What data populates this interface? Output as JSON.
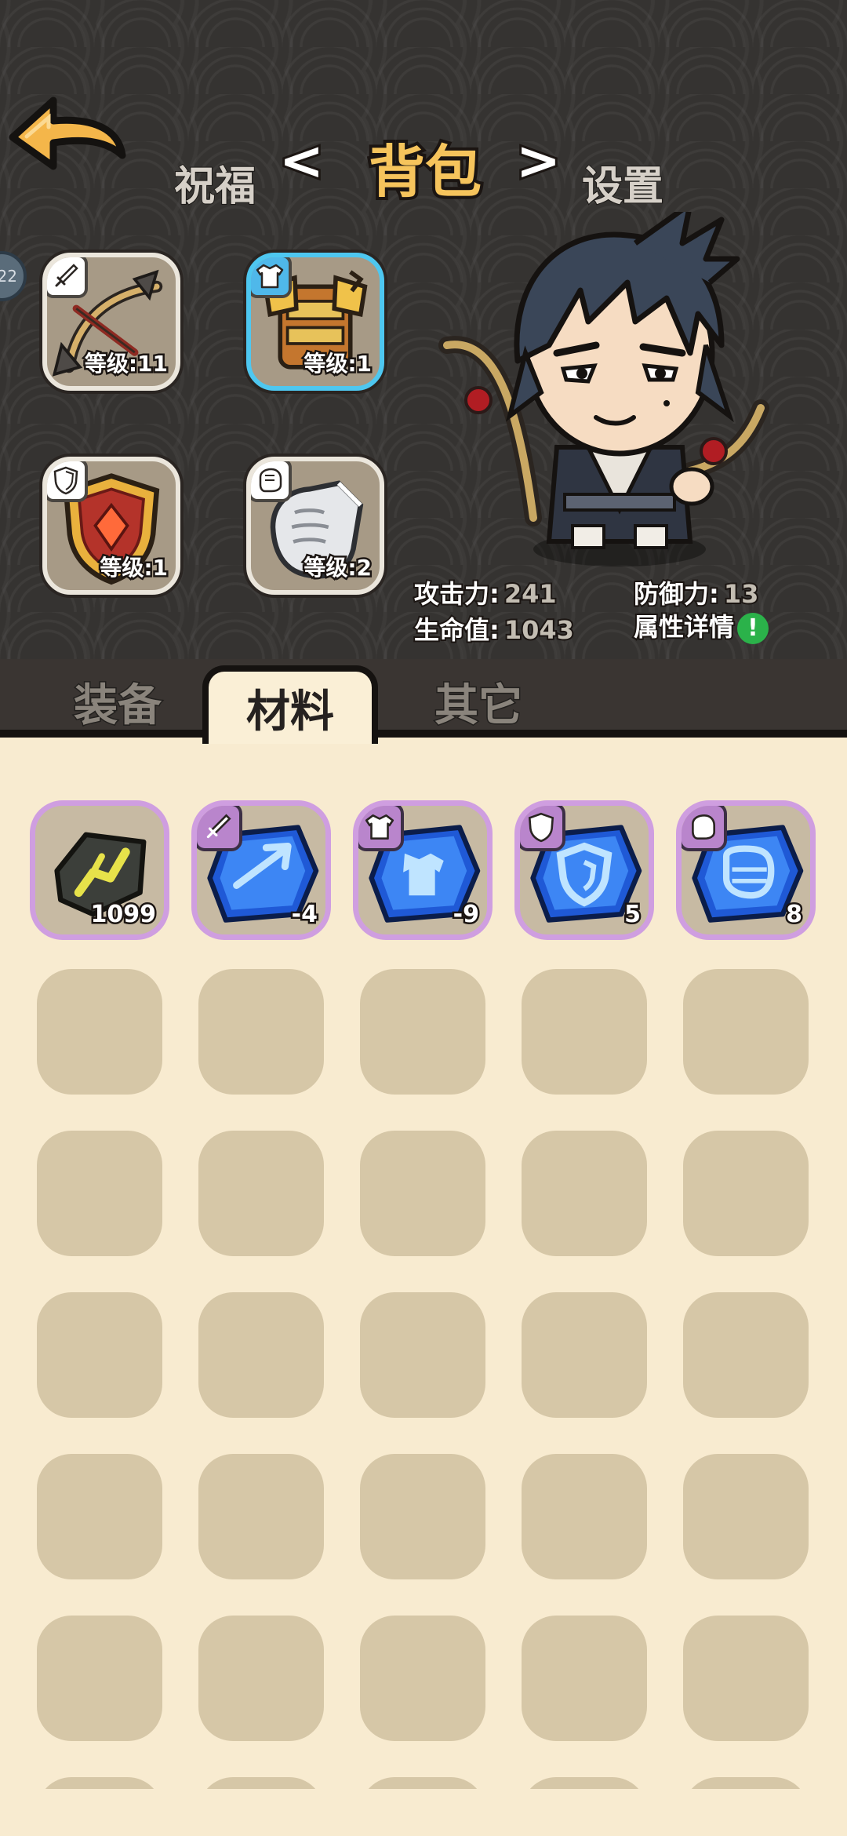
{
  "nav": {
    "left_label": "祝福",
    "title": "背包",
    "right_label": "设置",
    "prev_arrow": "<",
    "next_arrow": ">"
  },
  "player_level_badge": "22",
  "equipment": [
    {
      "slot": "weapon",
      "tag_icon": "dagger-icon",
      "level_text": "等级:11",
      "item": "crossbow"
    },
    {
      "slot": "armor",
      "tag_icon": "armor-icon",
      "level_text": "等级:1",
      "item": "golden-armor",
      "selected": true
    },
    {
      "slot": "shield",
      "tag_icon": "shield-icon",
      "level_text": "等级:1",
      "item": "gem-shield"
    },
    {
      "slot": "glove",
      "tag_icon": "glove-icon",
      "level_text": "等级:2",
      "item": "iron-gauntlet"
    }
  ],
  "stats": {
    "attack_label": "攻击力:",
    "attack_value": "241",
    "defense_label": "防御力:",
    "defense_value": "13",
    "hp_label": "生命值:",
    "hp_value": "1043",
    "details_label": "属性详情",
    "details_icon": "!"
  },
  "tabs": [
    {
      "label": "装备",
      "active": false
    },
    {
      "label": "材料",
      "active": true
    },
    {
      "label": "其它",
      "active": false
    }
  ],
  "materials": [
    {
      "name": "enhance-stone",
      "tag_icon": null,
      "count": "1099"
    },
    {
      "name": "weapon-crystal",
      "tag_icon": "dagger-icon",
      "count": "-4"
    },
    {
      "name": "armor-crystal",
      "tag_icon": "armor-icon",
      "count": "-9"
    },
    {
      "name": "shield-crystal",
      "tag_icon": "shield-icon",
      "count": "5"
    },
    {
      "name": "glove-crystal",
      "tag_icon": "glove-icon",
      "count": "8"
    }
  ],
  "colors": {
    "accent_title": "#f6c45c",
    "selected_border": "#4ec7f0",
    "rarity_purple": "#cf9ee0",
    "info_green": "#2bb24a",
    "panel_bg": "#f8ebd0",
    "empty_slot": "#d6c7a7"
  }
}
